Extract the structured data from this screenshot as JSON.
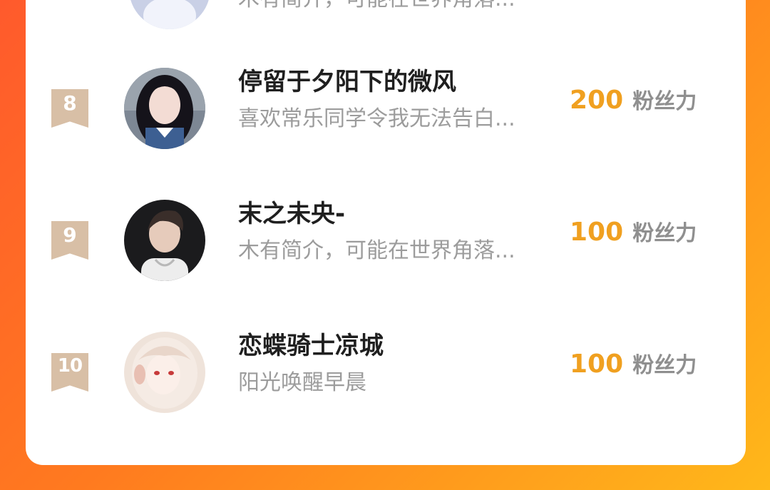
{
  "colors": {
    "background_start": "#ff5a2c",
    "background_end": "#ffb81a",
    "card": "#ffffff",
    "rank_badge": "#d8bfa6",
    "score": "#f0a020",
    "name": "#1f1f1f",
    "bio": "#9c9c9c"
  },
  "list": {
    "items": [
      {
        "bio": "木有简介，可能在世界角落..."
      },
      {
        "rank": "8",
        "name": "停留于夕阳下的微风",
        "bio": "喜欢常乐同学令我无法告白...",
        "score": "200",
        "unit": "粉丝力",
        "avatar_icon": "avatar-girl-icon"
      },
      {
        "rank": "9",
        "name": "末之未央-",
        "bio": "木有简介，可能在世界角落...",
        "score": "100",
        "unit": "粉丝力",
        "avatar_icon": "avatar-boy-icon"
      },
      {
        "rank": "10",
        "name": "恋蝶骑士凉城",
        "bio": "阳光唤醒早晨",
        "score": "100",
        "unit": "粉丝力",
        "avatar_icon": "avatar-anime-icon"
      }
    ]
  }
}
